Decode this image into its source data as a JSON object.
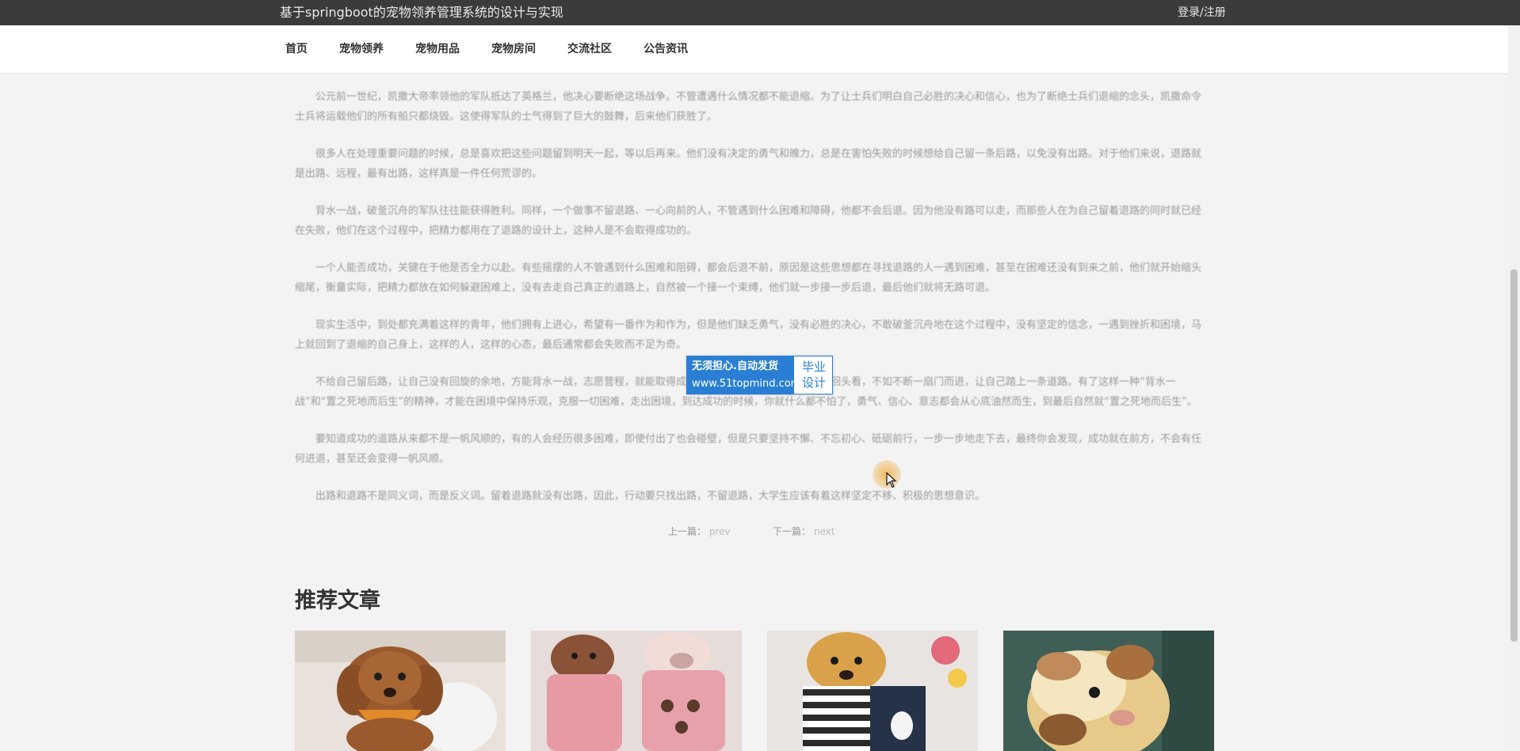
{
  "header": {
    "site_title": "基于springboot的宠物领养管理系统的设计与实现",
    "login_link": "登录/注册"
  },
  "nav": {
    "items": [
      {
        "label": "首页"
      },
      {
        "label": "宠物领养"
      },
      {
        "label": "宠物用品"
      },
      {
        "label": "宠物房间"
      },
      {
        "label": "交流社区"
      },
      {
        "label": "公告资讯"
      }
    ]
  },
  "article": {
    "paragraphs": [
      "公元前一世纪，凯撒大帝率领他的军队抵达了英格兰，他决心要断绝这场战争。不管遭遇什么情况都不能退缩。为了让士兵们明白自己必胜的决心和信心，也为了断绝士兵们退缩的念头，凯撒命令士兵将运载他们的所有船只都烧毁。这使得军队的士气得到了巨大的鼓舞，后来他们获胜了。",
      "很多人在处理重要问题的时候，总是喜欢把这些问题留到明天一起，等以后再来。他们没有决定的勇气和魄力，总是在害怕失败的时候想给自己留一条后路，以免没有出路。对于他们来说，退路就是出路、远程，最有出路，这样真是一件任何荒谬的。",
      "背水一战，破釜沉舟的军队往往能获得胜利。同样，一个做事不留退路、一心向前的人，不管遇到什么困难和障碍，他都不会后退。因为他没有路可以走，而那些人在为自己留着退路的同时就已经在失败，他们在这个过程中，把精力都用在了退路的设计上，这种人是不会取得成功的。",
      "一个人能否成功，关键在于他是否全力以赴。有些摇摆的人不管遇到什么困难和阻碍，都会后退不前，原因是这些思想都在寻找退路的人一遇到困难，甚至在困难还没有到来之前，他们就开始缩头缩尾，衡量实际，把精力都放在如何躲避困难上，没有去走自己真正的道路上，自然被一个接一个束缚，他们就一步接一步后退，最后他们就将无路可退。",
      "现实生活中，到处都充满着这样的青年，他们拥有上进心，希望有一番作为和作为，但是他们缺乏勇气，没有必胜的决心，不敢破釜沉舟地在这个过程中，没有坚定的信念，一遇到挫折和困境，马上就回到了退缩的自己身上，这样的人，这样的心态，最后通常都会失败而不足为奇。",
      "不给自己留后路，让自己没有回旋的余地，方能背水一战，志愿营程，就能取得成功。在前进的路上用力跑而不是回头看，不如不断一扇门而进，让自己踏上一条道路。有了这样一种“背水一战”和“置之死地而后生”的精神，才能在困境中保持乐观，克服一切困难，走出困境，到达成功的时候，你就什么都不怕了，勇气、信心、意志都会从心底油然而生，到最后自然就“置之死地而后生”。",
      "要知道成功的道路从来都不是一帆风顺的，有的人会经历很多困难，即使付出了也会碰壁，但是只要坚持不懈、不忘初心、砥砺前行，一步一步地走下去，最终你会发现，成功就在前方，不会有任何进退，甚至还会变得一帆风顺。",
      "出路和退路不是同义词，而是反义词。留着退路就没有出路，因此，行动要只找出路，不留退路，大学生应该有着这样坚定不移、积极的思想意识。"
    ]
  },
  "pager": {
    "prev_label": "上一篇：",
    "prev_title": "prev",
    "next_label": "下一篇：",
    "next_title": "next"
  },
  "recommend": {
    "title": "推荐文章",
    "cards": [
      {
        "image": "poodle-with-bandana-photo"
      },
      {
        "image": "poodle-in-pink-sweater-photo"
      },
      {
        "image": "puppy-in-striped-shirt-photo"
      },
      {
        "image": "guinea-pig-photo"
      }
    ]
  },
  "watermark": {
    "line1": "无须担心.自动发货",
    "line2": "www.51topmind.com",
    "right": "毕业设计"
  },
  "colors": {
    "topbar_bg": "#3b3b3b",
    "page_bg": "#f3f3f3",
    "watermark_blue": "#2a7fd4"
  }
}
